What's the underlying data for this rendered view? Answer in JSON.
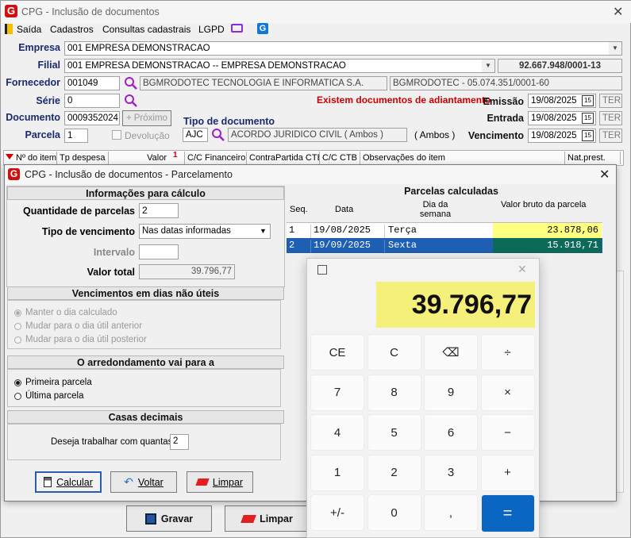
{
  "main_window": {
    "title": "CPG - Inclusão de documentos",
    "menu": [
      "Saída",
      "Cadastros",
      "Consultas cadastrais",
      "LGPD"
    ],
    "labels": {
      "empresa": "Empresa",
      "filial": "Filial",
      "fornecedor": "Fornecedor",
      "serie": "Série",
      "documento": "Documento",
      "parcela": "Parcela",
      "tipo_documento": "Tipo de documento",
      "emissao": "Emissão",
      "entrada": "Entrada",
      "vencimento": "Vencimento"
    },
    "empresa": "001 EMPRESA DEMONSTRACAO",
    "filial": "001 EMPRESA DEMONSTRACAO -- EMPRESA DEMONSTRACAO",
    "cnpj": "92.667.948/0001-13",
    "fornecedor_code": "001049",
    "fornecedor_name": "BGMRODOTEC TECNOLOGIA E INFORMATICA S.A.",
    "fornecedor_doc": "BGMRODOTEC - 05.074.351/0001-60",
    "serie": "0",
    "documento": "0009352024",
    "proximo_label": "Próximo",
    "parcela": "1",
    "devolucao_label": "Devolução",
    "tipo_doc_code": "AJC",
    "tipo_doc_desc": "ACORDO JURIDICO CIVIL ( Ambos )",
    "tipo_doc_ambos": "( Ambos )",
    "warning": "Existem documentos de adiantamento",
    "emissao": "19/08/2025",
    "entrada": "19/08/2025",
    "vencimento": "19/08/2025",
    "day_code": "TER",
    "grid_headers": [
      "Nº do item",
      "Tp despesa",
      "Valor",
      "C/C Financeiro",
      "ContraPartida CTB",
      "C/C CTB",
      "Observações do item",
      "Nat.prest."
    ],
    "grid_sort_num": "1",
    "gravar_label": "Gravar",
    "limpar_label": "Limpar"
  },
  "dialog": {
    "title": "CPG - Inclusão de documentos - Parcelamento",
    "info_header": "Informações para cálculo",
    "qtd_label": "Quantidade de parcelas",
    "qtd_value": "2",
    "tipo_venc_label": "Tipo de vencimento",
    "tipo_venc_value": "Nas datas informadas",
    "intervalo_label": "Intervalo",
    "valor_total_label": "Valor total",
    "valor_total_value": "39.796,77",
    "dias_header": "Vencimentos em dias não úteis",
    "dias_options": [
      "Manter o dia calculado",
      "Mudar para o dia útil anterior",
      "Mudar para o dia útil posterior"
    ],
    "arred_header": "O arredondamento vai para a",
    "arred_options": [
      "Primeira parcela",
      "Última parcela"
    ],
    "casas_header": "Casas decimais",
    "casas_label": "Deseja trabalhar com quantas",
    "casas_value": "2",
    "calcular_label": "Calcular",
    "voltar_label": "Voltar",
    "limpar_label": "Limpar",
    "parcelas_header": "Parcelas calculadas",
    "cols": [
      "Seq.",
      "Data",
      "Dia da semana",
      "Valor bruto da parcela"
    ],
    "rows": [
      {
        "seq": "1",
        "data": "19/08/2025",
        "dia": "Terça",
        "valor": "23.878,06"
      },
      {
        "seq": "2",
        "data": "19/09/2025",
        "dia": "Sexta",
        "valor": "15.918,71"
      }
    ]
  },
  "calculator": {
    "display": "39.796,77",
    "keys": [
      "CE",
      "C",
      "⌫",
      "÷",
      "7",
      "8",
      "9",
      "×",
      "4",
      "5",
      "6",
      "−",
      "1",
      "2",
      "3",
      "+",
      "+/-",
      "0",
      ",",
      "="
    ]
  },
  "colors": {
    "accent": "#0066cc",
    "warning": "#cc0000",
    "highlight": "#ffff80",
    "selected": "#1e5fb3",
    "calc_display": "#f4f07a",
    "label_blue": "#1a2a6c"
  }
}
